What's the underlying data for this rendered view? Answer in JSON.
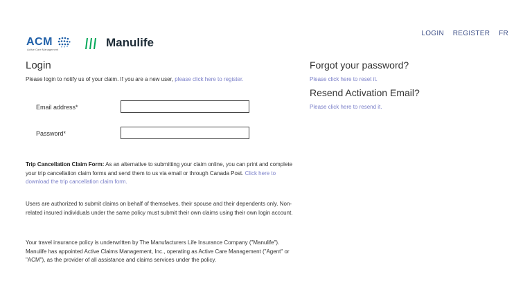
{
  "header": {
    "acm_logo_text": "ACM",
    "acm_logo_subtext": "Active Care Management",
    "manulife_logo_text": "Manulife",
    "nav": {
      "login": "LOGIN",
      "register": "REGISTER",
      "language": "FR"
    }
  },
  "login": {
    "title": "Login",
    "intro_text": "Please login to notify us of your claim. If you are a new user,",
    "register_link": "please click here to register.",
    "email_label": "Email address*",
    "email_value": "",
    "password_label": "Password*",
    "password_value": ""
  },
  "info": {
    "trip_heading": "Trip Cancellation Claim Form:",
    "trip_text": "As an alternative to submitting your claim online, you can print and complete your trip cancellation claim forms and send them to us via email or through Canada Post.",
    "trip_link": "Click here to download the trip cancellation claim form.",
    "users_text": "Users are authorized to submit claims on behalf of themselves, their spouse and their dependents only. Non-related insured individuals under the same policy must submit their own claims using their own login account.",
    "policy_text": "Your travel insurance policy is underwritten by The Manufacturers Life Insurance Company (\"Manulife\"). Manulife has appointed Active Claims Management, Inc., operating as Active Care Management (\"Agent\" or \"ACM\"), as the provider of all assistance and claims services under the policy."
  },
  "sidebar": {
    "forgot_title": "Forgot your password?",
    "forgot_link": "Please click here to reset it.",
    "resend_title": "Resend Activation Email?",
    "resend_link": "Please click here to resend it."
  },
  "colors": {
    "link": "#7a7fc8",
    "nav": "#3d4f87",
    "acm_blue": "#1f5fa8",
    "manulife_green": "#00a758"
  }
}
